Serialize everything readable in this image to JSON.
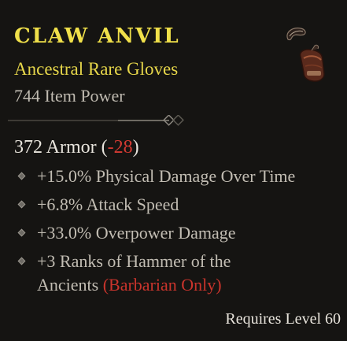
{
  "item": {
    "name": "CLAW ANVIL",
    "type": "Ancestral Rare Gloves",
    "power": "744 Item Power",
    "image_icon": "gloves-icon"
  },
  "armor": {
    "label": "372 Armor",
    "open_paren": " (",
    "delta": "-28",
    "close_paren": ")"
  },
  "affixes": [
    "+15.0% Physical Damage Over Time",
    "+6.8% Attack Speed",
    "+33.0% Overpower Damage",
    "+3 Ranks of Hammer of the"
  ],
  "affix_continuation": {
    "text": "Ancients",
    "restriction": "(Barbarian Only)"
  },
  "requirement": "Requires Level 60",
  "colors": {
    "rare_name": "#f0e04a",
    "rare_type": "#e6d64a",
    "negative": "#d33a32",
    "background": "#151412"
  }
}
